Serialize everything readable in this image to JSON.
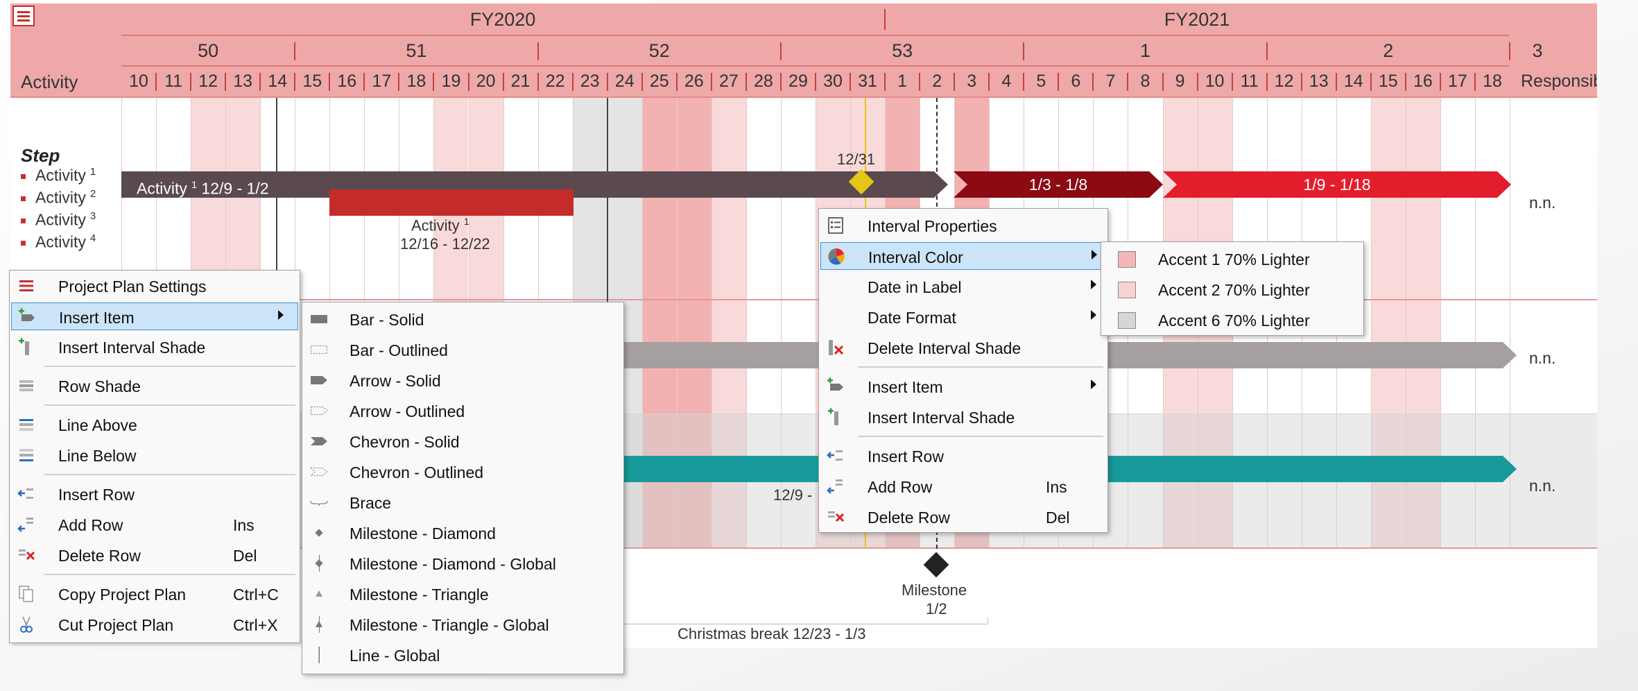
{
  "header": {
    "activity_label": "Activity",
    "responsible_label": "Responsible",
    "fiscal_years": [
      "FY2020",
      "FY2021"
    ],
    "weeks": [
      "50",
      "51",
      "52",
      "53",
      "1",
      "2",
      "3"
    ],
    "days": [
      "10",
      "11",
      "12",
      "13",
      "14",
      "15",
      "16",
      "17",
      "18",
      "19",
      "20",
      "21",
      "22",
      "23",
      "24",
      "25",
      "26",
      "27",
      "28",
      "29",
      "30",
      "31",
      "1",
      "2",
      "3",
      "4",
      "5",
      "6",
      "7",
      "8",
      "9",
      "10",
      "11",
      "12",
      "13",
      "14",
      "15",
      "16",
      "17",
      "18"
    ]
  },
  "rows": {
    "step_title": "Step",
    "activities": [
      {
        "name": "Activity",
        "sup": "1"
      },
      {
        "name": "Activity",
        "sup": "2"
      },
      {
        "name": "Activity",
        "sup": "3"
      },
      {
        "name": "Activity",
        "sup": "4"
      }
    ],
    "main_bar": {
      "name": "Activity",
      "sup": "1",
      "dates": "12/9 - 1/2"
    },
    "seg2_label": "1/3 - 1/8",
    "seg3_label": "1/9 - 1/18",
    "diamond_label": "12/31",
    "red_bar": {
      "name": "Activity",
      "sup": "1",
      "dates": "12/16 - 12/22"
    },
    "teal_label": "12/9 -",
    "responsible": [
      "n.n.",
      "n.n.",
      "n.n."
    ],
    "milestone": {
      "name": "Milestone",
      "date": "1/2"
    },
    "christmas_break": "Christmas break 12/23 - 1/3"
  },
  "colors": {
    "header": "#eea8a8",
    "dark_bar": "#5a4a4f",
    "dark_red": "#8b0a14",
    "bright_red": "#e31e2c",
    "red_bar": "#c42b2b",
    "gray_bar": "#a59fa0",
    "teal_bar": "#189a9a",
    "milestone_gold": "#e5c517",
    "menu_highlight": "#cce4f7"
  },
  "menu_left": {
    "items": [
      {
        "label": "Project Plan Settings",
        "icon": "hamburger-icon"
      },
      {
        "label": "Insert Item",
        "icon": "insert-item-icon",
        "submenu": true
      },
      {
        "label": "Insert Interval Shade",
        "icon": "insert-shade-icon"
      },
      {
        "label": "Row Shade",
        "icon": "row-shade-icon"
      },
      {
        "label": "Line Above",
        "icon": "line-above-icon"
      },
      {
        "label": "Line Below",
        "icon": "line-below-icon"
      },
      {
        "label": "Insert Row",
        "icon": "insert-row-icon"
      },
      {
        "label": "Add Row",
        "shortcut": "Ins",
        "icon": "add-row-icon"
      },
      {
        "label": "Delete Row",
        "shortcut": "Del",
        "icon": "delete-row-icon"
      },
      {
        "label": "Copy Project Plan",
        "shortcut": "Ctrl+C",
        "icon": "copy-icon"
      },
      {
        "label": "Cut Project Plan",
        "shortcut": "Ctrl+X",
        "icon": "scissors-icon"
      }
    ]
  },
  "menu_insert": {
    "items": [
      {
        "label": "Bar - Solid",
        "icon": "bar-solid-icon"
      },
      {
        "label": "Bar - Outlined",
        "icon": "bar-outlined-icon"
      },
      {
        "label": "Arrow - Solid",
        "icon": "arrow-solid-icon"
      },
      {
        "label": "Arrow - Outlined",
        "icon": "arrow-outlined-icon"
      },
      {
        "label": "Chevron - Solid",
        "icon": "chevron-solid-icon"
      },
      {
        "label": "Chevron - Outlined",
        "icon": "chevron-outlined-icon"
      },
      {
        "label": "Brace",
        "icon": "brace-icon"
      },
      {
        "label": "Milestone - Diamond",
        "icon": "diamond-icon"
      },
      {
        "label": "Milestone - Diamond - Global",
        "icon": "diamond-global-icon"
      },
      {
        "label": "Milestone - Triangle",
        "icon": "triangle-icon"
      },
      {
        "label": "Milestone - Triangle - Global",
        "icon": "triangle-global-icon"
      },
      {
        "label": "Line - Global",
        "icon": "line-global-icon"
      }
    ]
  },
  "menu_interval": {
    "items": [
      {
        "label": "Interval Properties",
        "icon": "properties-icon"
      },
      {
        "label": "Interval Color",
        "icon": "color-wheel-icon",
        "submenu": true
      },
      {
        "label": "Date in Label",
        "submenu": true
      },
      {
        "label": "Date Format",
        "submenu": true
      },
      {
        "label": "Delete Interval Shade",
        "icon": "delete-shade-icon"
      },
      {
        "label": "Insert Item",
        "icon": "insert-item-icon",
        "submenu": true
      },
      {
        "label": "Insert Interval Shade",
        "icon": "insert-shade-icon"
      },
      {
        "label": "Insert Row",
        "icon": "insert-row-icon"
      },
      {
        "label": "Add Row",
        "shortcut": "Ins",
        "icon": "add-row-icon"
      },
      {
        "label": "Delete Row",
        "shortcut": "Del",
        "icon": "delete-row-icon"
      }
    ]
  },
  "menu_color": {
    "items": [
      {
        "label": "Accent 1 70% Lighter",
        "color": "#f4b6b6"
      },
      {
        "label": "Accent 2 70% Lighter",
        "color": "#f8d2d2"
      },
      {
        "label": "Accent 6 70% Lighter",
        "color": "#d6d6d6"
      }
    ]
  }
}
